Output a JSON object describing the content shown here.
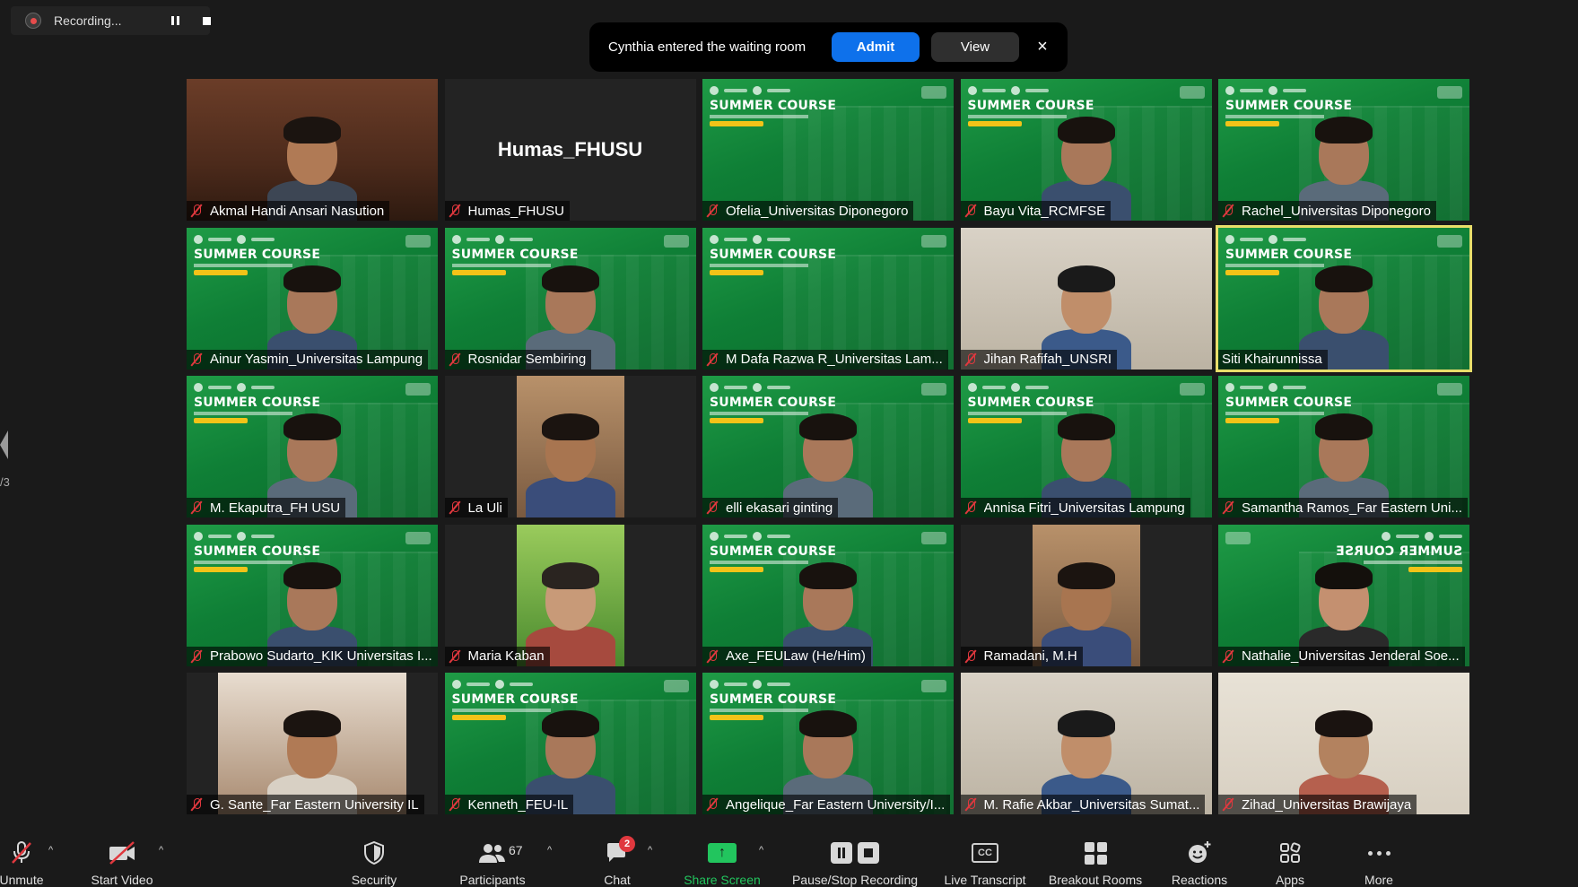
{
  "recording": {
    "label": "Recording..."
  },
  "toast": {
    "message": "Cynthia entered the waiting room",
    "admit_label": "Admit",
    "view_label": "View",
    "close_glyph": "×"
  },
  "gallery": {
    "active_speaker": "Siti Khairunnissa",
    "banner_text": "SUMMER COURSE",
    "page_indicator": "/3",
    "participants": [
      {
        "name": "Akmal Handi Ansari Nasution",
        "muted": true,
        "video": "room"
      },
      {
        "name": "Humas_FHUSU",
        "muted": true,
        "video": "off",
        "display_name": "Humas_FHUSU"
      },
      {
        "name": "Ofelia_Universitas Diponegoro",
        "muted": true,
        "video": "banner"
      },
      {
        "name": "Bayu Vita_RCMFSE",
        "muted": true,
        "video": "banner"
      },
      {
        "name": "Rachel_Universitas Diponegoro",
        "muted": true,
        "video": "banner"
      },
      {
        "name": "Ainur Yasmin_Universitas Lampung",
        "muted": true,
        "video": "banner"
      },
      {
        "name": "Rosnidar  Sembiring",
        "muted": true,
        "video": "banner"
      },
      {
        "name": "M Dafa Razwa R_Universitas Lam...",
        "muted": true,
        "video": "banner"
      },
      {
        "name": "Jihan Rafifah_UNSRI",
        "muted": true,
        "video": "light"
      },
      {
        "name": "Siti Khairunnissa",
        "muted": false,
        "video": "banner",
        "speaking": true
      },
      {
        "name": "M. Ekaputra_FH USU",
        "muted": true,
        "video": "banner"
      },
      {
        "name": "La Uli",
        "muted": true,
        "video": "inset"
      },
      {
        "name": "elli ekasari ginting",
        "muted": true,
        "video": "banner"
      },
      {
        "name": "Annisa Fitri_Universitas Lampung",
        "muted": true,
        "video": "banner"
      },
      {
        "name": "Samantha Ramos_Far Eastern Uni...",
        "muted": true,
        "video": "banner"
      },
      {
        "name": "Prabowo Sudarto_KIK Universitas I...",
        "muted": true,
        "video": "banner"
      },
      {
        "name": "Maria Kaban",
        "muted": true,
        "video": "inset-green"
      },
      {
        "name": "Axe_FEULaw (He/Him)",
        "muted": true,
        "video": "banner"
      },
      {
        "name": "Ramadani, M.H",
        "muted": true,
        "video": "inset"
      },
      {
        "name": "Nathalie_Universitas Jenderal Soe...",
        "muted": true,
        "video": "banner-mirror"
      },
      {
        "name": "G. Sante_Far Eastern University IL",
        "muted": true,
        "video": "inset-wide"
      },
      {
        "name": "Kenneth_FEU-IL",
        "muted": true,
        "video": "banner"
      },
      {
        "name": "Angelique_Far Eastern University/I...",
        "muted": true,
        "video": "banner"
      },
      {
        "name": "M. Rafie Akbar_Universitas Sumat...",
        "muted": true,
        "video": "light"
      },
      {
        "name": "Zihad_Universitas Brawijaya",
        "muted": true,
        "video": "pale"
      }
    ]
  },
  "toolbar": {
    "unmute_label": "Unmute",
    "start_video_label": "Start Video",
    "security_label": "Security",
    "participants_label": "Participants",
    "participants_count": "67",
    "chat_label": "Chat",
    "chat_badge": "2",
    "share_label": "Share Screen",
    "recording_label": "Pause/Stop Recording",
    "transcript_label": "Live Transcript",
    "transcript_icon_text": "CC",
    "breakout_label": "Breakout Rooms",
    "reactions_label": "Reactions",
    "apps_label": "Apps",
    "more_label": "More",
    "caret_glyph": "^"
  },
  "colors": {
    "accent_blue": "#0e71eb",
    "muted_red": "#e0383e",
    "speaker_yellow": "#e8de6a",
    "share_green": "#22c55e",
    "banner_green": "#0f7f36"
  }
}
